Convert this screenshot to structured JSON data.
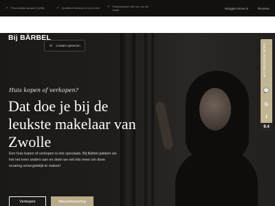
{
  "topbar": {
    "features": [
      {
        "icon": "check-icon",
        "text": "Persoonlijke aanpak (bij Bij)"
      },
      {
        "icon": "check-icon",
        "text": "Opvallend bekend en (zo) meer"
      },
      {
        "icon": "check-icon",
        "text": "Professioneel met hoe van de markt"
      }
    ],
    "links": [
      "Inloggen Move.nl",
      "Reviews"
    ]
  },
  "brand": {
    "logo": "Bij BÄRBEL"
  },
  "contact": {
    "label": "Contact opnemen",
    "icon": "phone-icon"
  },
  "hero": {
    "tagline": "Huis kopen of verkopen?",
    "headline": "Dat doe je bij de leukste makelaar van Zwolle",
    "intro": "Een huis kopen of verkopen is iets speciaals. Bij Bärbel pakken we het net even anders aan en doen we net iets meer om deze ervaring onvergetelijk te maken!",
    "buttons": {
      "sell": "Verkopen",
      "valuation": "Waardebepaling"
    }
  },
  "reviews": {
    "label": "ONZE REVIEWS OP",
    "score": "9.4",
    "icons": [
      "chat-icon",
      "google-icon",
      "facebook-icon",
      "star-icon"
    ]
  },
  "colors": {
    "accent": "#b9ab8a",
    "dark": "#1b1a19"
  }
}
